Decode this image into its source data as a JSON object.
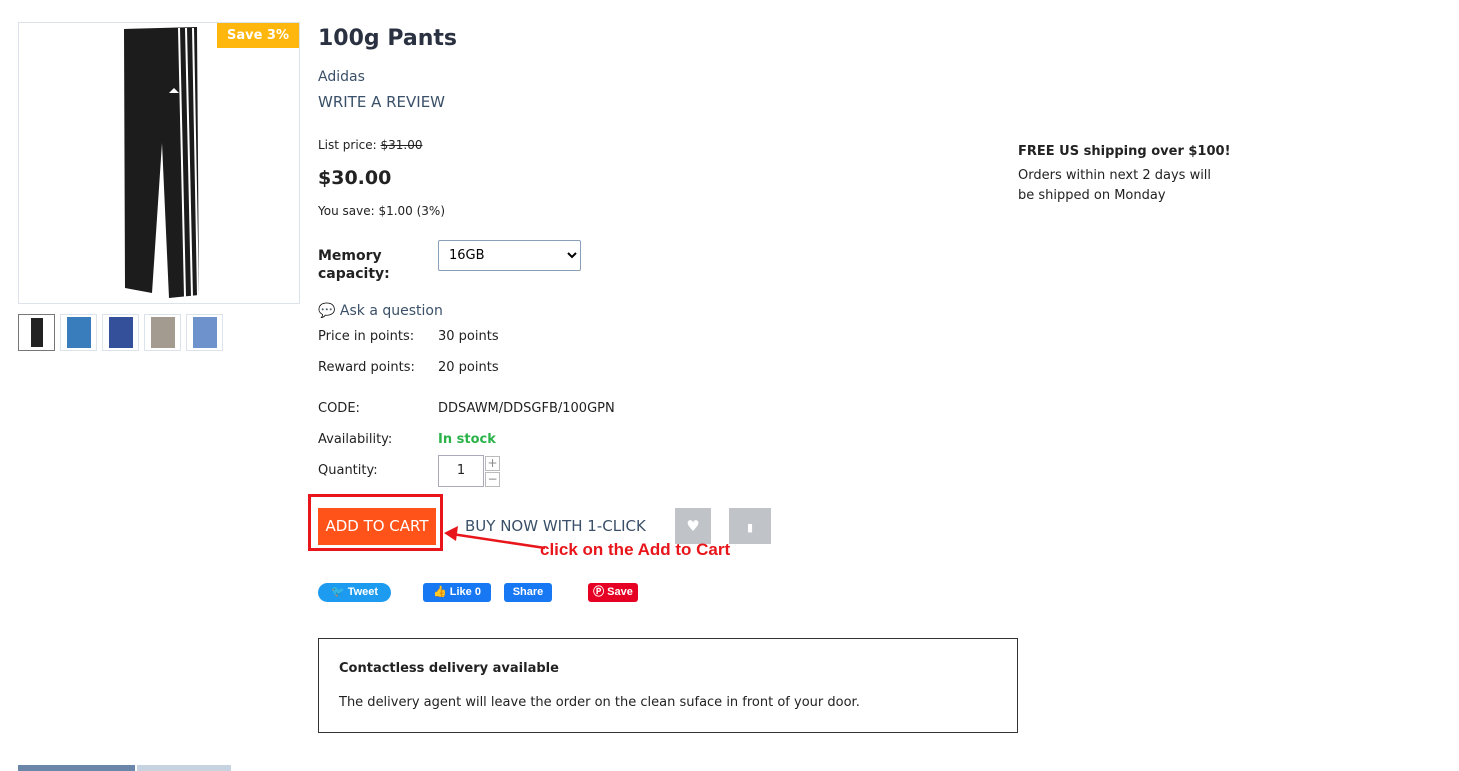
{
  "product": {
    "title": "100g Pants",
    "brand": "Adidas",
    "review_link": "WRITE A REVIEW",
    "badge": "Save 3%",
    "list_price_label": "List price:",
    "list_price": "$31.00",
    "price": "$30.00",
    "you_save": "You save: $1.00 (3%)",
    "option_label": "Memory capacity:",
    "option_value": "16GB",
    "ask": "Ask a question",
    "details": [
      {
        "label": "Price in points:",
        "value": "30 points"
      },
      {
        "label": "Reward points:",
        "value": "20 points"
      },
      {
        "label": "CODE:",
        "value": "DDSAWM/DDSGFB/100GPN"
      },
      {
        "label": "Availability:",
        "value": "In stock"
      },
      {
        "label": "Quantity:",
        "value": "1"
      }
    ],
    "thumbnails": [
      "black-pants",
      "ripped-jeans",
      "blue-jeans",
      "grey-pants",
      "light-jeans"
    ]
  },
  "actions": {
    "add_to_cart": "ADD TO CART",
    "buy_now": "BUY NOW WITH 1-CLICK",
    "annotation": "click on the Add to Cart"
  },
  "social": {
    "tweet": "Tweet",
    "like": "Like 0",
    "share": "Share",
    "save": "Save"
  },
  "shipping": {
    "title": "FREE US shipping over $100!",
    "text": "Orders within next 2 days will be shipped on Monday"
  },
  "delivery": {
    "title": "Contactless delivery available",
    "text": "The delivery agent will leave the order on the clean suface in front of your door."
  },
  "colors": {
    "accent": "#ff5319",
    "badge": "#ffb60d",
    "in_stock": "#2bb34a",
    "annotation": "#e8161b"
  }
}
